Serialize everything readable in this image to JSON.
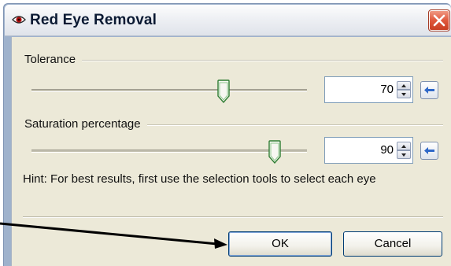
{
  "window": {
    "title": "Red Eye Removal"
  },
  "tolerance": {
    "label": "Tolerance",
    "value": "70",
    "level_percent": 70
  },
  "saturation": {
    "label": "Saturation percentage",
    "value": "90",
    "level_percent": 90
  },
  "hint": "Hint: For best results, first use the selection tools to select each eye",
  "buttons": {
    "ok": "OK",
    "cancel": "Cancel"
  },
  "colors": {
    "title_text": "#0b1a33",
    "close_button": "#e0583c",
    "dialog_background": "#ece9d8",
    "thumb_green": "#2f7d33"
  }
}
